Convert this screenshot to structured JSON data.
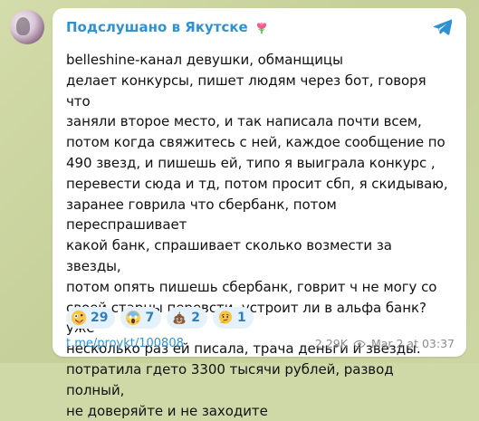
{
  "channel": {
    "name": "Подслушано в Якутске"
  },
  "message": {
    "text": "belleshine-канал девушки, обманщицы\nделает конкурсы, пишет людям через бот, говоря что\nзаняли второе место, и так написала почти всем,\nпотом когда свяжитесь с ней, каждое сообщение по\n490 звезд, и пишешь ей, типо я выиграла конкурс ,\nперевести сюда и тд, потом просит сбп, я скидываю,\nзаранее говрила что сбербанк, потом переспрашивает\nкакой банк, спрашивает сколько возмести за звезды,\nпотом опять пишешь сбербанк, говрит ч не могу со\nсвоей старны перевсти, устроит ли в альфа банк? уже\nнесколько раз ей писала, трача деньги и звезды.\nпотратила гдето 3300 тысячи рублей, развод полный,\nне доверяйте и не заходите"
  },
  "reactions": [
    {
      "icon": "crazy-face-icon",
      "count": "29"
    },
    {
      "icon": "screaming-face-icon",
      "count": "7"
    },
    {
      "icon": "poop-icon",
      "count": "2"
    },
    {
      "icon": "thinking-face-icon",
      "count": "1"
    }
  ],
  "footer": {
    "link": "t.me/proykt/100808",
    "views": "2.29K",
    "date": "Mar 2 at 03:37"
  },
  "colors": {
    "accent": "#2f92d0",
    "reaction_bg": "#e6f2fb",
    "reaction_text": "#2f7fbd",
    "meta_text": "#8c8c8c",
    "background": "#cfd8a7"
  }
}
